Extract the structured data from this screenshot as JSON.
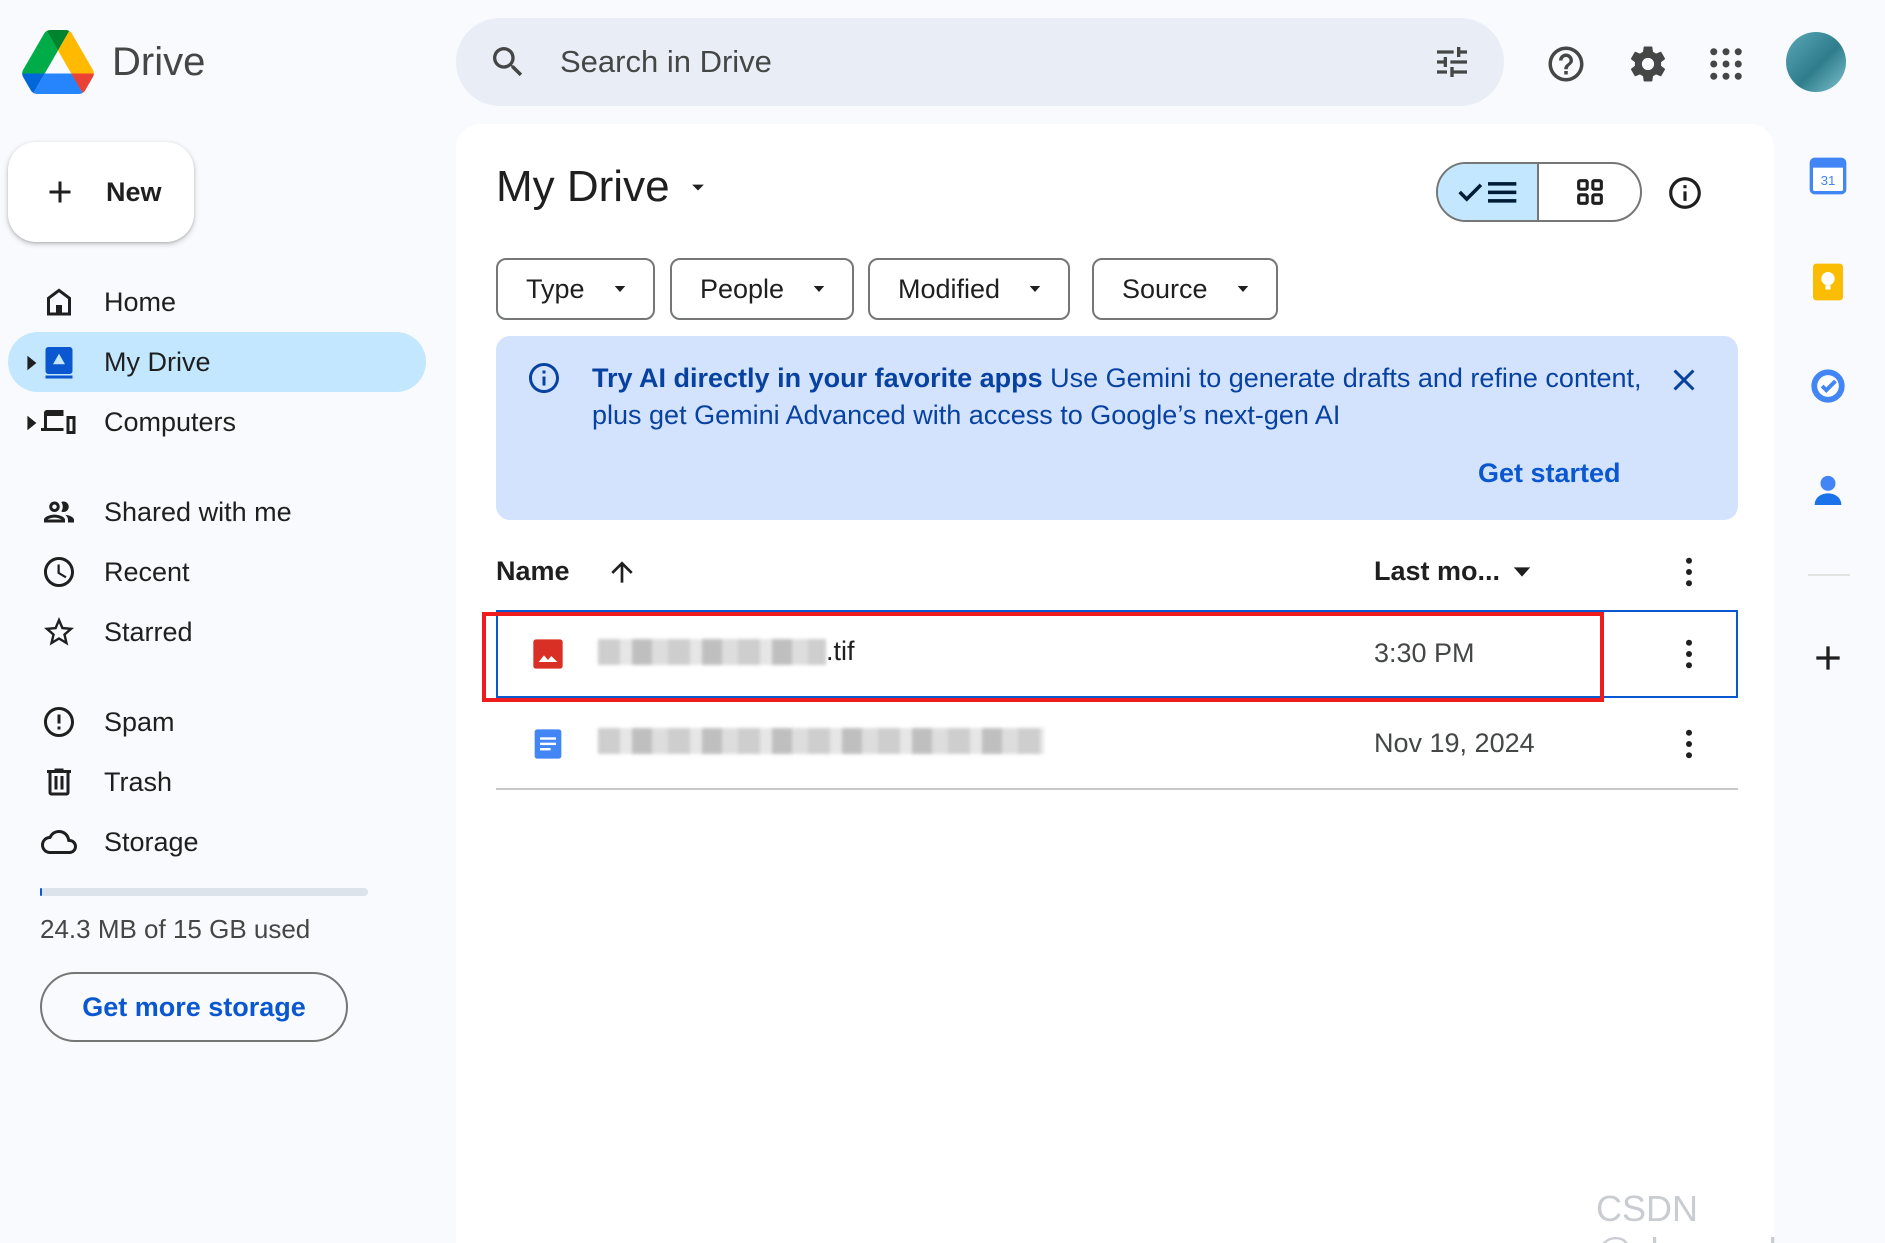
{
  "app": {
    "name": "Drive"
  },
  "search": {
    "placeholder": "Search in Drive"
  },
  "sidebar": {
    "new_label": "New",
    "items": [
      {
        "label": "Home"
      },
      {
        "label": "My Drive"
      },
      {
        "label": "Computers"
      },
      {
        "label": "Shared with me"
      },
      {
        "label": "Recent"
      },
      {
        "label": "Starred"
      },
      {
        "label": "Spam"
      },
      {
        "label": "Trash"
      },
      {
        "label": "Storage"
      }
    ],
    "storage_used_fraction": 0.0016,
    "storage_text": "24.3 MB of 15 GB used",
    "get_more_storage": "Get more storage"
  },
  "main": {
    "title": "My Drive",
    "view_mode": "list",
    "filters": [
      {
        "label": "Type"
      },
      {
        "label": "People"
      },
      {
        "label": "Modified"
      },
      {
        "label": "Source"
      }
    ],
    "banner": {
      "headline": "Try AI directly in your favorite apps",
      "body": "Use Gemini to generate drafts and refine content, plus get Gemini Advanced with access to Google’s next-gen AI",
      "cta": "Get started"
    },
    "columns": {
      "name": "Name",
      "modified": "Last mo..."
    },
    "files": [
      {
        "name_suffix": ".tif",
        "type": "image",
        "modified": "3:30 PM",
        "selected": true
      },
      {
        "name_suffix": "",
        "type": "doc",
        "modified": "Nov 19, 2024",
        "selected": false
      }
    ]
  },
  "icons": {
    "search": "search-icon",
    "tune": "tune-icon",
    "help": "help-icon",
    "settings": "gear-icon",
    "apps": "apps-grid-icon"
  },
  "colors": {
    "accent": "#0b57d0",
    "active_nav": "#c2e7ff",
    "banner_bg": "#d3e3fd",
    "highlight": "#ee1c1c"
  },
  "watermark": "CSDN @zhou_x_b"
}
